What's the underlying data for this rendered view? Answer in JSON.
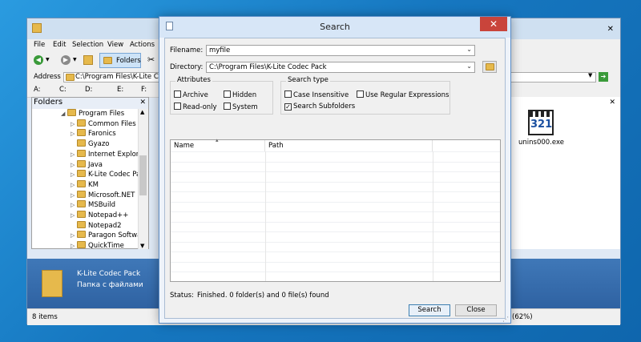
{
  "explorer": {
    "menu": [
      "File",
      "Edit",
      "Selection",
      "View",
      "Actions"
    ],
    "folders_button": "Folders",
    "address_label": "Address",
    "address_value": "C:\\Program Files\\K-Lite Co",
    "drives": [
      "A:",
      "C:",
      "D:",
      "E:",
      "F:"
    ],
    "folders_pane_title": "Folders",
    "tree": [
      {
        "label": "Program Files",
        "level": 0,
        "expand": "◢"
      },
      {
        "label": "Common Files",
        "level": 1,
        "expand": "▷"
      },
      {
        "label": "Faronics",
        "level": 1,
        "expand": "▷"
      },
      {
        "label": "Gyazo",
        "level": 1,
        "expand": ""
      },
      {
        "label": "Internet Explore",
        "level": 1,
        "expand": "▷"
      },
      {
        "label": "Java",
        "level": 1,
        "expand": "▷"
      },
      {
        "label": "K-Lite Codec Pa",
        "level": 1,
        "expand": "▷"
      },
      {
        "label": "KM",
        "level": 1,
        "expand": "▷"
      },
      {
        "label": "Microsoft.NET",
        "level": 1,
        "expand": "▷"
      },
      {
        "label": "MSBuild",
        "level": 1,
        "expand": "▷"
      },
      {
        "label": "Notepad++",
        "level": 1,
        "expand": "▷"
      },
      {
        "label": "Notepad2",
        "level": 1,
        "expand": ""
      },
      {
        "label": "Paragon Softwa",
        "level": 1,
        "expand": "▷"
      },
      {
        "label": "QuickTime",
        "level": 1,
        "expand": "▷"
      }
    ],
    "file_name": "unins000.exe",
    "detail_title": "K-Lite Codec Pack",
    "detail_subtitle": "Папка с файлами",
    "status_left": "8 items",
    "status_right": "(62%)"
  },
  "dialog": {
    "title": "Search",
    "filename_label": "Filename:",
    "filename_value": "myfile",
    "directory_label": "Directory:",
    "directory_value": "C:\\Program Files\\K-Lite Codec Pack",
    "attributes_title": "Attributes",
    "attributes": [
      {
        "label": "Archive",
        "checked": false
      },
      {
        "label": "Hidden",
        "checked": false
      },
      {
        "label": "Read-only",
        "checked": false
      },
      {
        "label": "System",
        "checked": false
      }
    ],
    "search_type_title": "Search type",
    "search_types": [
      {
        "label": "Case Insensitive",
        "checked": false
      },
      {
        "label": "Use Regular Expressions",
        "checked": false
      },
      {
        "label": "Search Subfolders",
        "checked": true
      }
    ],
    "columns": [
      "Name",
      "Path"
    ],
    "status_label": "Status:",
    "status_text": "Finished. 0 folder(s) and 0 file(s) found",
    "search_button": "Search",
    "close_button": "Close",
    "close_glyph": "✕"
  },
  "colors": {
    "accent": "#3c7fb1",
    "close_red": "#c9443b",
    "folder": "#e6b94c"
  }
}
